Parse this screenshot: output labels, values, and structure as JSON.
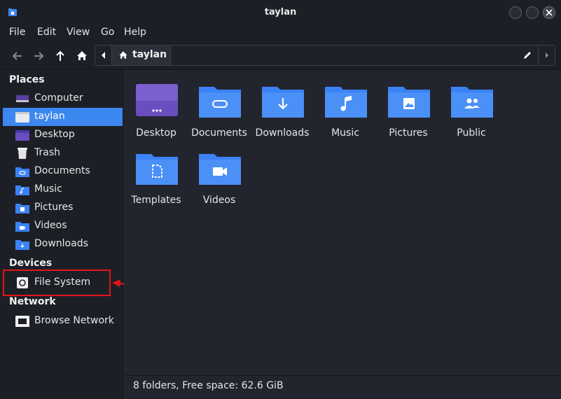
{
  "window": {
    "title": "taylan"
  },
  "menu": [
    "File",
    "Edit",
    "View",
    "Go",
    "Help"
  ],
  "toolbar": {
    "back_icon": "arrow-left-icon",
    "forward_icon": "arrow-right-icon",
    "up_icon": "arrow-up-icon",
    "home_icon": "home-icon"
  },
  "pathbar": {
    "current": "taylan"
  },
  "sidebar": {
    "places_title": "Places",
    "places": [
      {
        "label": "Computer",
        "icon": "computer-icon"
      },
      {
        "label": "taylan",
        "icon": "home-folder-icon"
      },
      {
        "label": "Desktop",
        "icon": "desktop-icon"
      },
      {
        "label": "Trash",
        "icon": "trash-icon"
      },
      {
        "label": "Documents",
        "icon": "folder-documents-icon"
      },
      {
        "label": "Music",
        "icon": "folder-music-icon"
      },
      {
        "label": "Pictures",
        "icon": "folder-pictures-icon"
      },
      {
        "label": "Videos",
        "icon": "folder-videos-icon"
      },
      {
        "label": "Downloads",
        "icon": "folder-downloads-icon"
      }
    ],
    "devices_title": "Devices",
    "devices": [
      {
        "label": "File System",
        "icon": "drive-icon"
      }
    ],
    "network_title": "Network",
    "network": [
      {
        "label": "Browse Network",
        "icon": "network-icon"
      }
    ]
  },
  "folders": [
    {
      "label": "Desktop",
      "icon": "desktop-folder-icon"
    },
    {
      "label": "Documents",
      "icon": "documents-folder-icon"
    },
    {
      "label": "Downloads",
      "icon": "downloads-folder-icon"
    },
    {
      "label": "Music",
      "icon": "music-folder-icon"
    },
    {
      "label": "Pictures",
      "icon": "pictures-folder-icon"
    },
    {
      "label": "Public",
      "icon": "public-folder-icon"
    },
    {
      "label": "Templates",
      "icon": "templates-folder-icon"
    },
    {
      "label": "Videos",
      "icon": "videos-folder-icon"
    }
  ],
  "status": {
    "text": "8 folders, Free space: 62.6 GiB"
  },
  "colors": {
    "accent": "#3c87f0",
    "annotation": "#e0151b",
    "folder": "#3b82f6"
  }
}
